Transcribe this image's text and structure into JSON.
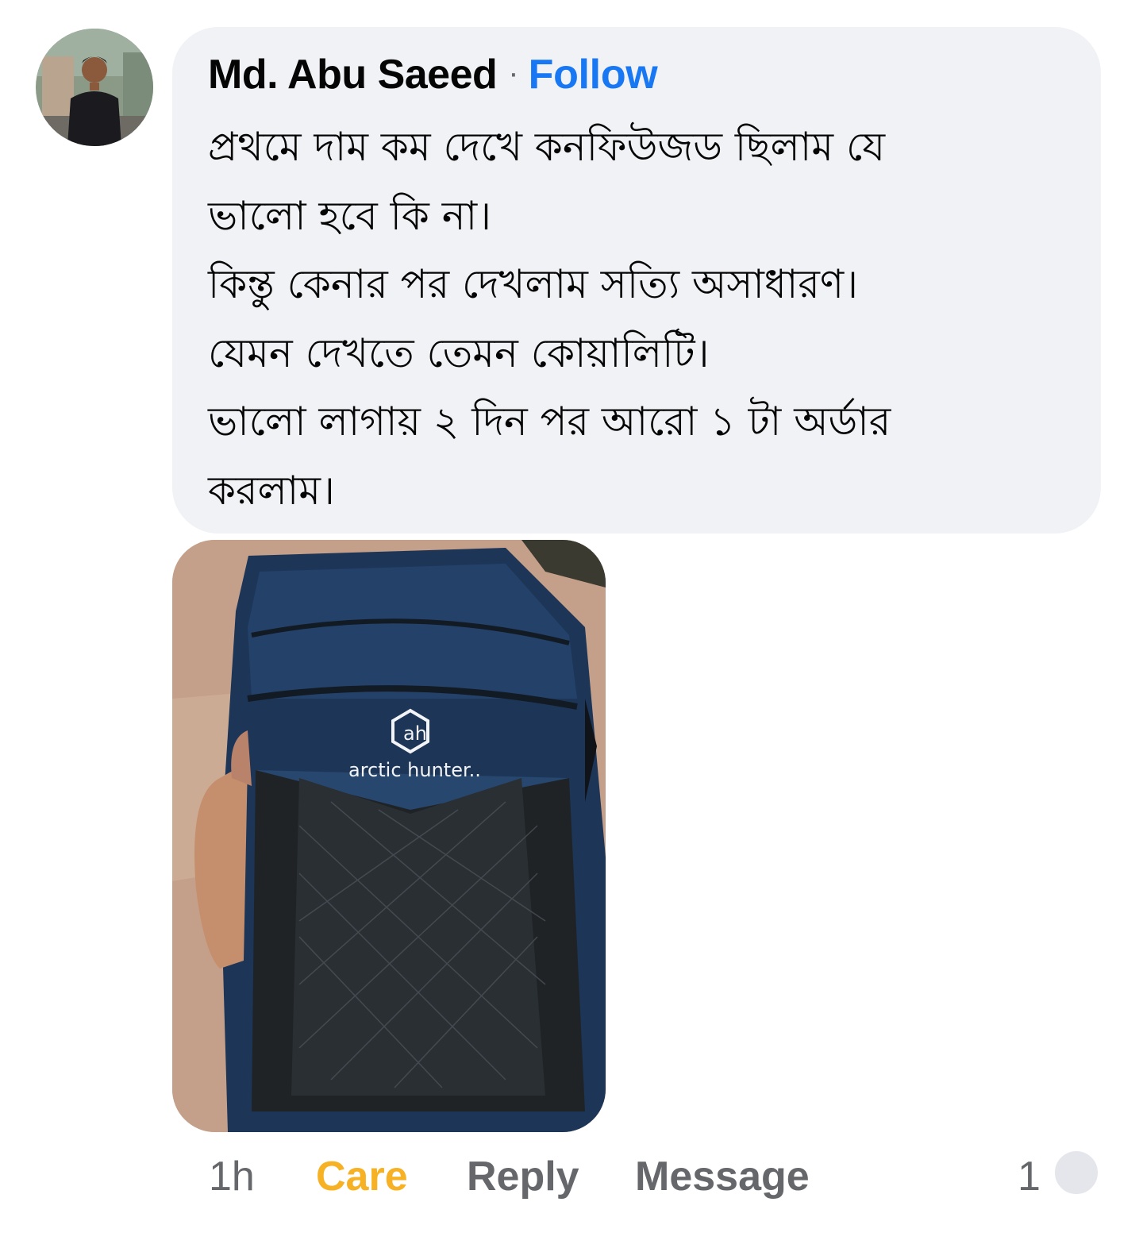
{
  "comment": {
    "author": "Md. Abu Saeed",
    "separator": "·",
    "follow_label": "Follow",
    "lines": [
      "প্রথমে দাম কম দেখে কনফিউজড ছিলাম যে",
      "ভালো হবে কি না।",
      "কিন্তু কেনার পর দেখলাম সত্যি অসাধারণ।",
      "যেমন দেখতে তেমন কোয়ালিটি।",
      "ভালো লাগায় ২ দিন পর আরো ১ টা অর্ডার",
      "করলাম।"
    ]
  },
  "photo": {
    "brand_text": "arctic hunter..",
    "colors": {
      "bag_blue": "#1f3a5e",
      "panel_black": "#23272a",
      "floor": "#c9a58c"
    }
  },
  "actions": {
    "time": "1h",
    "reaction_label": "Care",
    "reply_label": "Reply",
    "message_label": "Message",
    "reaction_count": "1"
  },
  "colors": {
    "bubble_bg": "#f0f2f5",
    "follow_blue": "#1877f2",
    "care_yellow": "#f7b125",
    "action_gray": "#65676b"
  }
}
